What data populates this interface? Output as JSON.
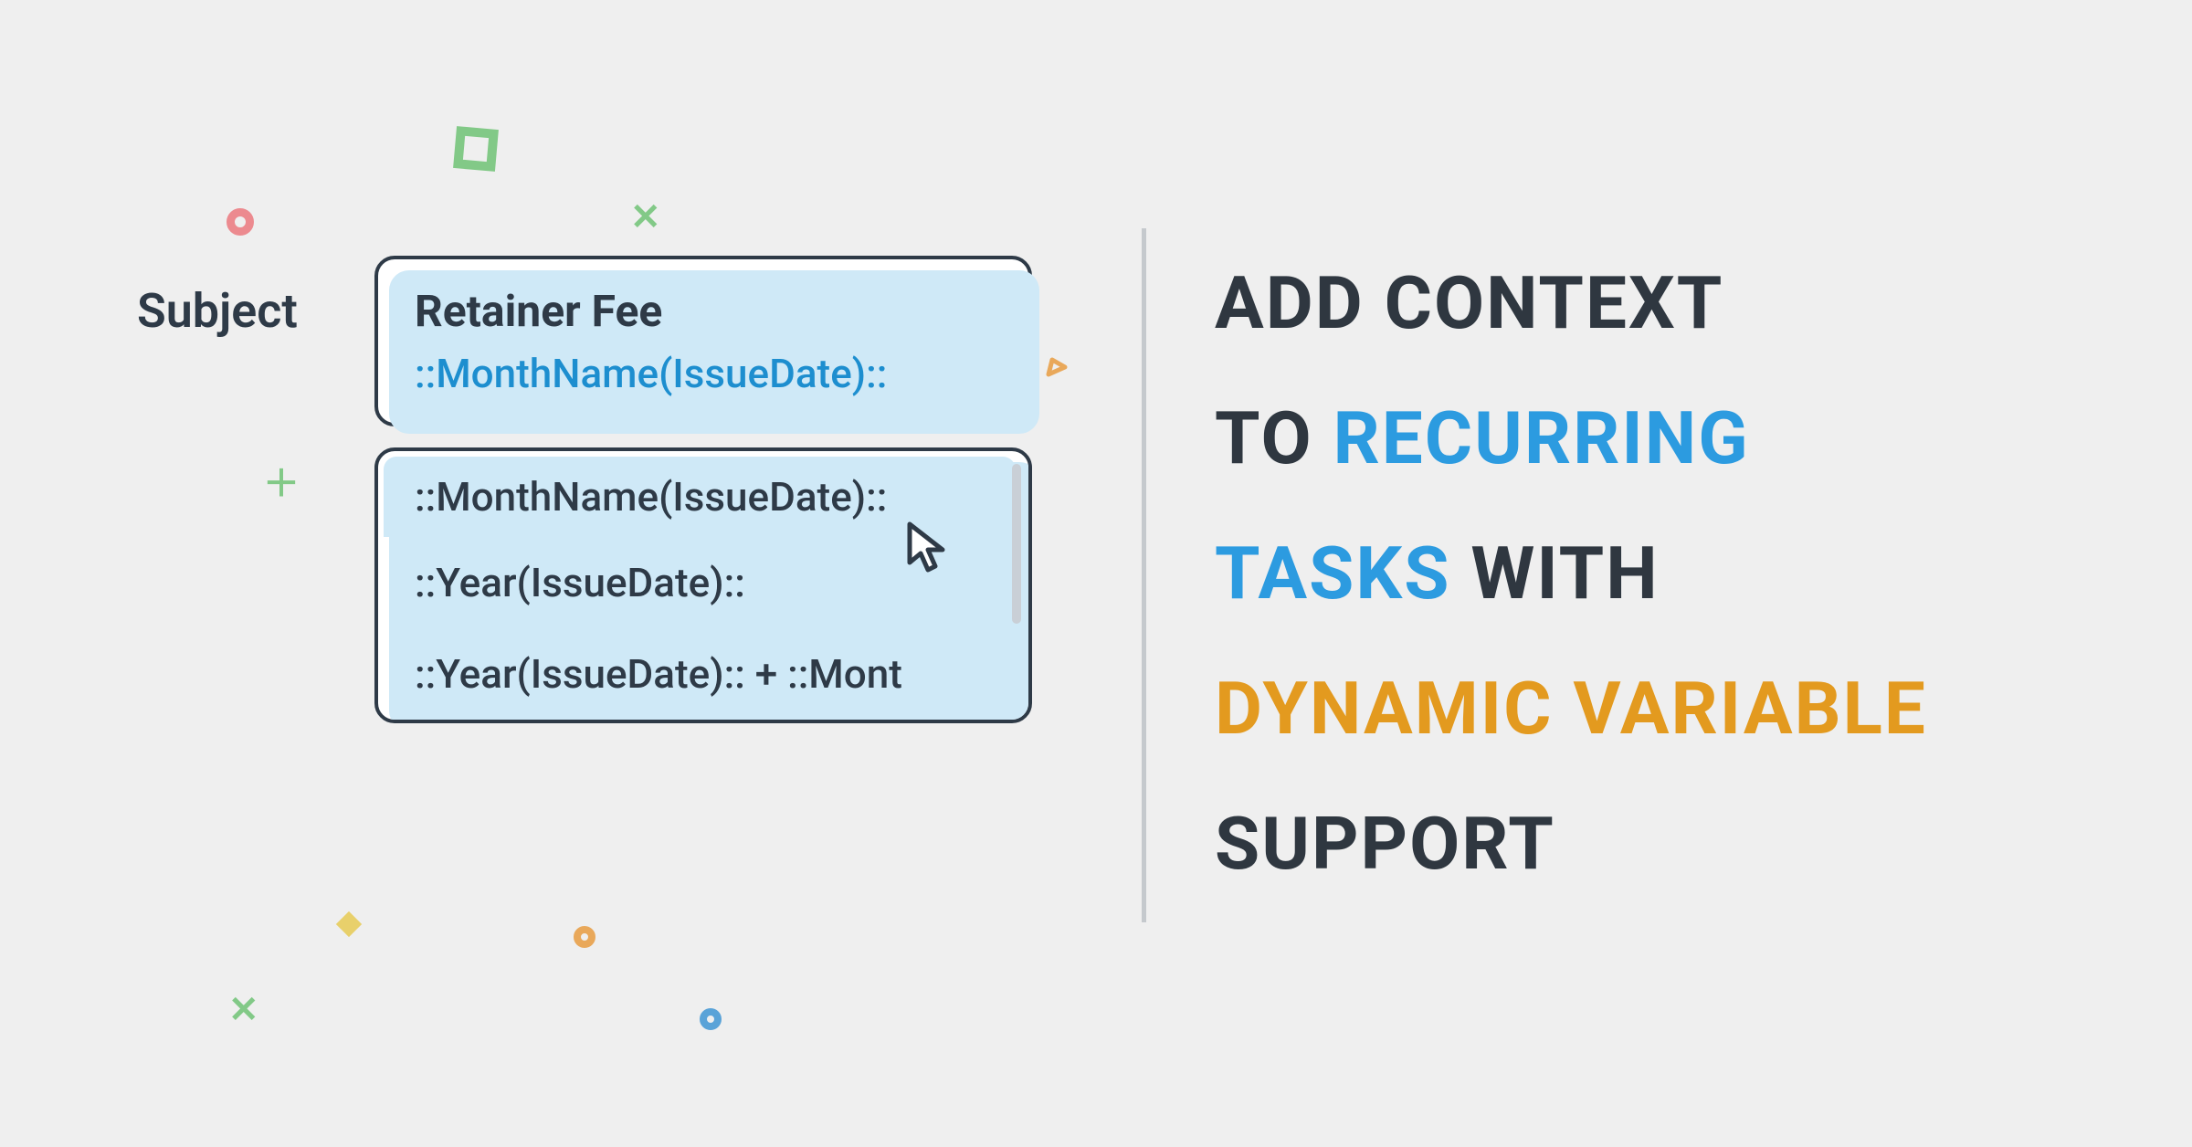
{
  "subject": {
    "label": "Subject",
    "title": "Retainer Fee",
    "variable": "::MonthName(IssueDate)::"
  },
  "dropdown": {
    "items": [
      "::MonthName(IssueDate)::",
      "::Year(IssueDate)::",
      "::Year(IssueDate):: + ::Mont"
    ]
  },
  "headline": {
    "l1a": "Add context",
    "l2a": "to ",
    "l2b": "recurring",
    "l3a": "tasks",
    "l3b": " with",
    "l4a": "dynamic variable",
    "l5a": "support"
  }
}
